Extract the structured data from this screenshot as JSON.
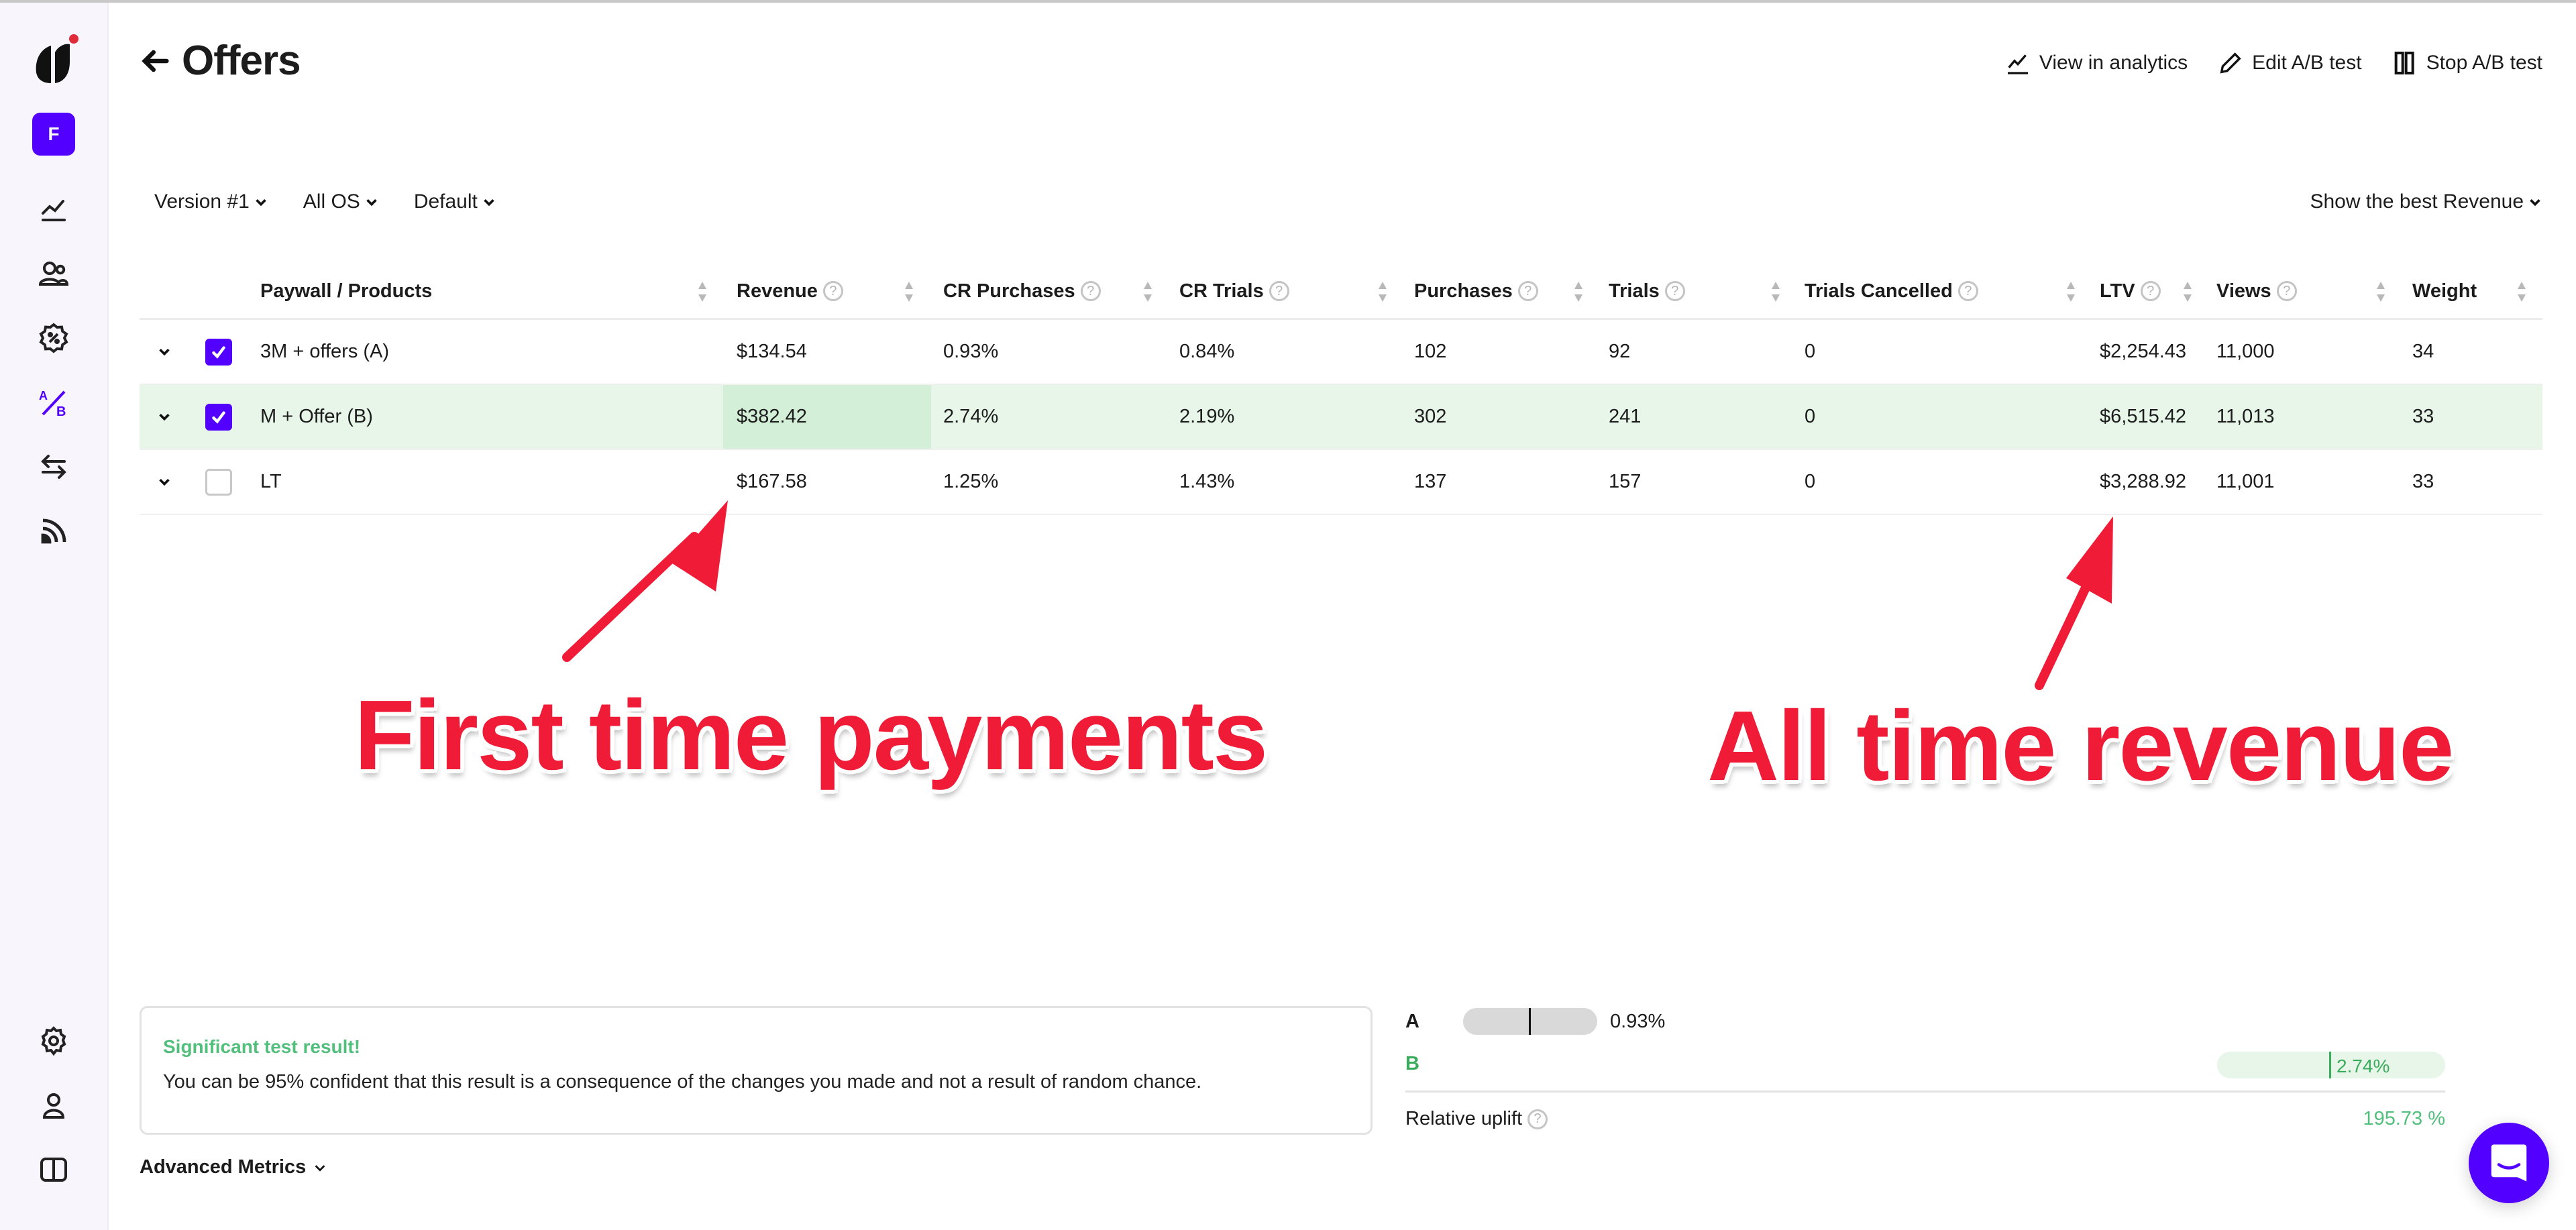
{
  "app": {
    "org_initial": "F",
    "accent_color": "#5200ff",
    "success_color": "#52bf7c",
    "annotation_color": "#f01b36"
  },
  "sidebar": {
    "items": [
      {
        "name": "analytics",
        "icon": "chart-line-icon",
        "active": false
      },
      {
        "name": "profiles",
        "icon": "users-icon",
        "active": false
      },
      {
        "name": "promotions",
        "icon": "discount-badge-icon",
        "active": false
      },
      {
        "name": "ab-tests",
        "icon": "ab-test-icon",
        "active": true
      },
      {
        "name": "transactions",
        "icon": "swap-arrows-icon",
        "active": false
      },
      {
        "name": "events",
        "icon": "feed-icon",
        "active": false
      }
    ],
    "bottom_items": [
      {
        "name": "settings",
        "icon": "gear-icon"
      },
      {
        "name": "account",
        "icon": "user-icon"
      },
      {
        "name": "docs",
        "icon": "book-icon"
      }
    ]
  },
  "header": {
    "title": "Offers",
    "actions": [
      {
        "label": "View in analytics",
        "icon": "chart-line-icon"
      },
      {
        "label": "Edit A/B test",
        "icon": "pencil-icon"
      },
      {
        "label": "Stop A/B test",
        "icon": "pause-icon"
      }
    ]
  },
  "filters": {
    "version": "Version #1",
    "os": "All OS",
    "segment": "Default",
    "best_metric": "Show the best Revenue"
  },
  "table": {
    "columns": [
      {
        "label": "Paywall / Products",
        "help": false
      },
      {
        "label": "Revenue",
        "help": true
      },
      {
        "label": "CR Purchases",
        "help": true
      },
      {
        "label": "CR Trials",
        "help": true
      },
      {
        "label": "Purchases",
        "help": true
      },
      {
        "label": "Trials",
        "help": true
      },
      {
        "label": "Trials Cancelled",
        "help": true
      },
      {
        "label": "LTV",
        "help": true
      },
      {
        "label": "Views",
        "help": true
      },
      {
        "label": "Weight",
        "help": false
      }
    ],
    "rows": [
      {
        "checked": true,
        "winner": false,
        "cells": [
          "3M + offers (A)",
          "$134.54",
          "0.93%",
          "0.84%",
          "102",
          "92",
          "0",
          "$2,254.43",
          "11,000",
          "34"
        ]
      },
      {
        "checked": true,
        "winner": true,
        "cells": [
          "M + Offer (B)",
          "$382.42",
          "2.74%",
          "2.19%",
          "302",
          "241",
          "0",
          "$6,515.42",
          "11,013",
          "33"
        ]
      },
      {
        "checked": false,
        "winner": false,
        "cells": [
          "LT",
          "$167.58",
          "1.25%",
          "1.43%",
          "137",
          "157",
          "0",
          "$3,288.92",
          "11,001",
          "33"
        ]
      }
    ]
  },
  "annotations": {
    "left": "First time payments",
    "right": "All time revenue"
  },
  "result": {
    "title": "Significant test result!",
    "body": "You can be 95% confident that this result is a consequence of the changes you made and not a result of random chance.",
    "advanced_label": "Advanced Metrics"
  },
  "comparison": {
    "a_label": "A",
    "a_value": "0.93%",
    "b_label": "B",
    "b_value": "2.74%",
    "uplift_label": "Relative uplift",
    "uplift_value": "195.73 %"
  }
}
